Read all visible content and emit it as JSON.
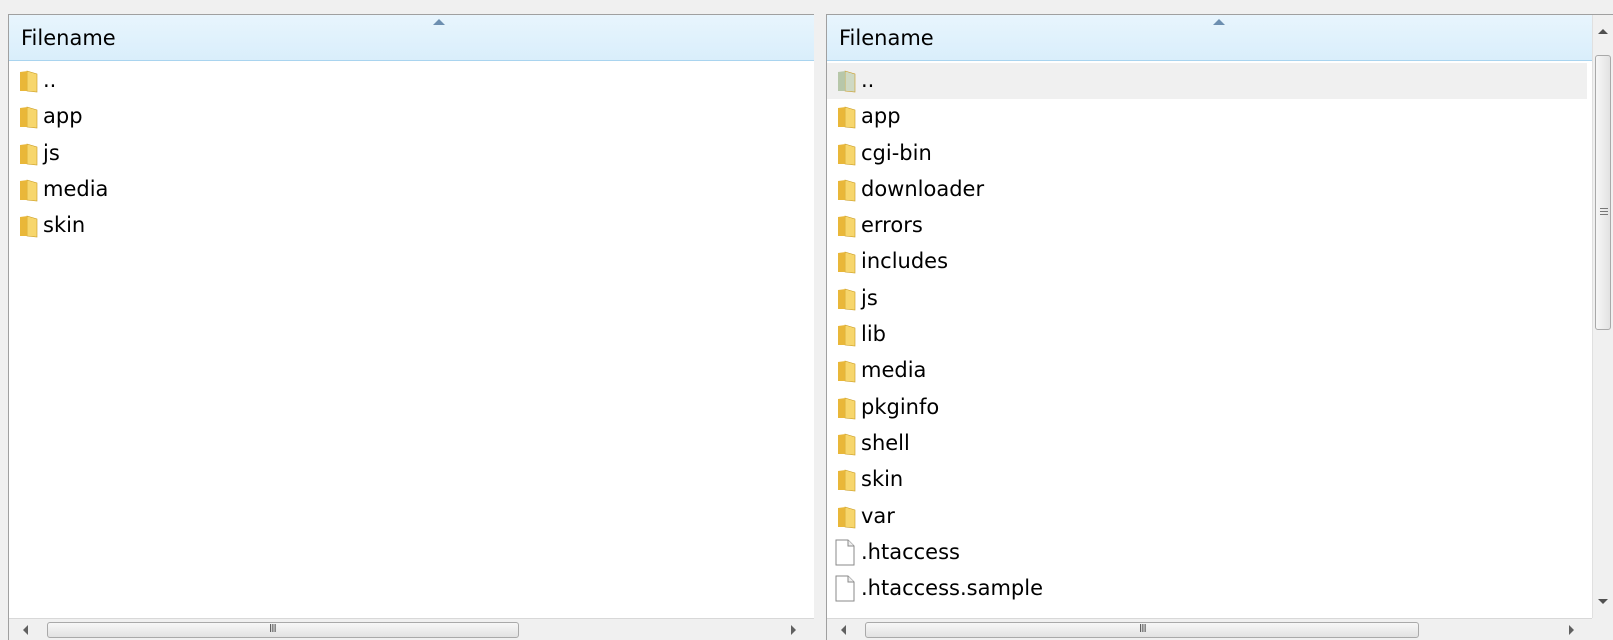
{
  "local_pane": {
    "header": "Filename",
    "items": [
      {
        "name": "..",
        "icon": "folder-icon"
      },
      {
        "name": "app",
        "icon": "folder-icon"
      },
      {
        "name": "js",
        "icon": "folder-icon"
      },
      {
        "name": "media",
        "icon": "folder-icon"
      },
      {
        "name": "skin",
        "icon": "folder-icon"
      }
    ]
  },
  "remote_pane": {
    "header": "Filename",
    "items": [
      {
        "name": "..",
        "icon": "folder-icon"
      },
      {
        "name": "app",
        "icon": "folder-icon"
      },
      {
        "name": "cgi-bin",
        "icon": "folder-icon"
      },
      {
        "name": "downloader",
        "icon": "folder-icon"
      },
      {
        "name": "errors",
        "icon": "folder-icon"
      },
      {
        "name": "includes",
        "icon": "folder-icon"
      },
      {
        "name": "js",
        "icon": "folder-icon"
      },
      {
        "name": "lib",
        "icon": "folder-icon"
      },
      {
        "name": "media",
        "icon": "folder-icon"
      },
      {
        "name": "pkginfo",
        "icon": "folder-icon"
      },
      {
        "name": "shell",
        "icon": "folder-icon"
      },
      {
        "name": "skin",
        "icon": "folder-icon"
      },
      {
        "name": "var",
        "icon": "folder-icon"
      },
      {
        "name": ".htaccess",
        "icon": "file-icon"
      },
      {
        "name": ".htaccess.sample",
        "icon": "file-icon"
      }
    ]
  },
  "colors": {
    "folder": "#f2c84b",
    "header_bg": "#ddeffb",
    "selection": "#f0f0f0"
  }
}
